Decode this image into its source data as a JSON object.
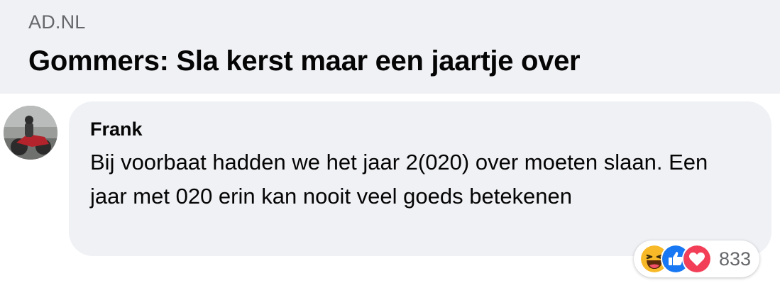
{
  "link_preview": {
    "domain": "AD.NL",
    "title": "Gommers: Sla kerst maar een jaartje over"
  },
  "comment": {
    "author": "Frank",
    "text": "Bij voorbaat hadden we het jaar 2(020) over moeten slaan. Een jaar met 020 erin kan nooit veel goeds betekenen",
    "reactions": {
      "icons": [
        "haha-icon",
        "like-icon",
        "love-icon"
      ],
      "count": "833"
    }
  },
  "colors": {
    "preview_background": "#f0f1f5",
    "bubble_background": "#f0f1f5",
    "like_blue": "#1877f2",
    "love_red": "#f33e58",
    "haha_yellow": "#f7b928"
  }
}
